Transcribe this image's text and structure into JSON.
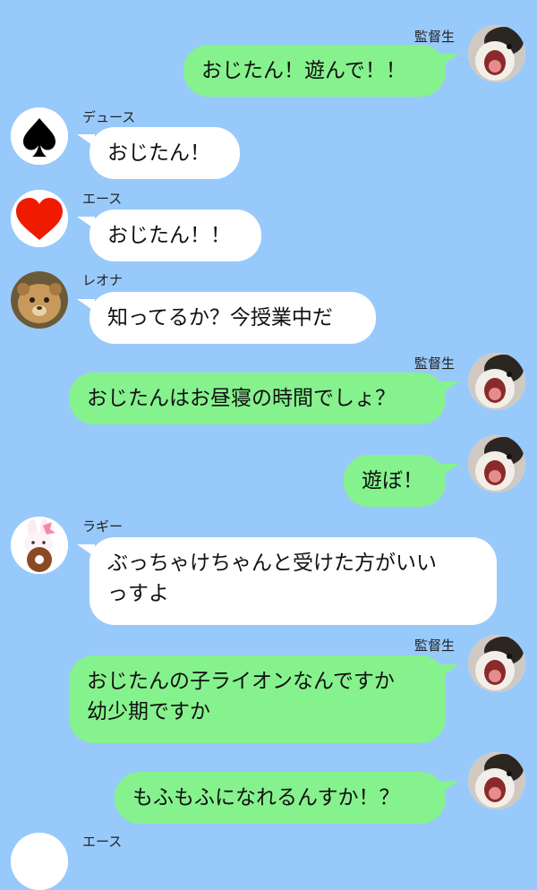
{
  "messages": [
    {
      "sender": "監督生",
      "text": "おじたん！遊んで！！",
      "side": "right",
      "avatar": "cat-yawning-avatar"
    },
    {
      "sender": "デュース",
      "text": "おじたん！",
      "side": "left",
      "avatar": "spade-icon"
    },
    {
      "sender": "エース",
      "text": "おじたん！！",
      "side": "left",
      "avatar": "heart-icon"
    },
    {
      "sender": "レオナ",
      "text": "知ってるか？今授業中だ",
      "side": "left",
      "avatar": "lion-cub-avatar"
    },
    {
      "sender": "監督生",
      "text": "おじたんはお昼寝の時間でしょ？",
      "side": "right",
      "avatar": "cat-yawning-avatar"
    },
    {
      "sender": "",
      "text": "遊ぼ！",
      "side": "right",
      "avatar": "cat-yawning-avatar"
    },
    {
      "sender": "ラギー",
      "text": "ぶっちゃけちゃんと受けた方がいい\nっすよ",
      "side": "left",
      "avatar": "bunny-donut-avatar"
    },
    {
      "sender": "監督生",
      "text": "おじたんの子ライオンなんですか\n幼少期ですか",
      "side": "right",
      "avatar": "cat-yawning-avatar"
    },
    {
      "sender": "",
      "text": "もふもふになれるんすか！？",
      "side": "right",
      "avatar": "cat-yawning-avatar"
    },
    {
      "sender": "エース",
      "text": "",
      "side": "left",
      "avatar": "heart-icon"
    }
  ],
  "colors": {
    "background": "#98c9fb",
    "own_bubble": "#86f28e",
    "other_bubble": "#ffffff"
  }
}
